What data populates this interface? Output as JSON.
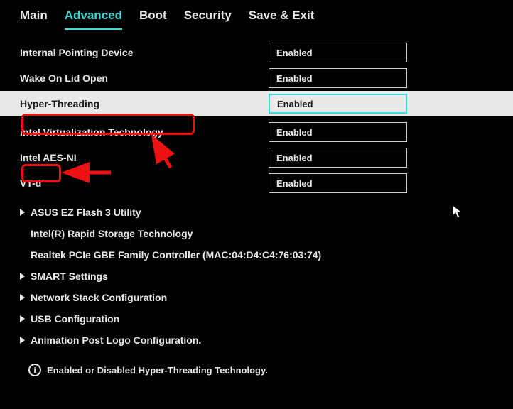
{
  "tabs": {
    "main": "Main",
    "advanced": "Advanced",
    "boot": "Boot",
    "security": "Security",
    "save_exit": "Save & Exit",
    "active": "advanced"
  },
  "settings": {
    "internal_pointing": {
      "label": "Internal Pointing Device",
      "value": "Enabled"
    },
    "wake_lid": {
      "label": "Wake On Lid Open",
      "value": "Enabled"
    },
    "hyper_threading": {
      "label": "Hyper-Threading",
      "value": "Enabled"
    },
    "intel_vt": {
      "label": "Intel Virtualization Technology",
      "value": "Enabled"
    },
    "intel_aes": {
      "label": "Intel AES-NI",
      "value": "Enabled"
    },
    "vtd": {
      "label": "VT-d",
      "value": "Enabled"
    }
  },
  "submenus": {
    "ez_flash": "ASUS EZ Flash 3 Utility",
    "rapid_storage": "Intel(R) Rapid Storage Technology",
    "realtek": "Realtek PCIe GBE Family Controller (MAC:04:D4:C4:76:03:74)",
    "smart": "SMART Settings",
    "netstack": "Network Stack Configuration",
    "usb": "USB Configuration",
    "animation": "Animation Post Logo Configuration."
  },
  "help_text": "Enabled or Disabled Hyper-Threading Technology."
}
